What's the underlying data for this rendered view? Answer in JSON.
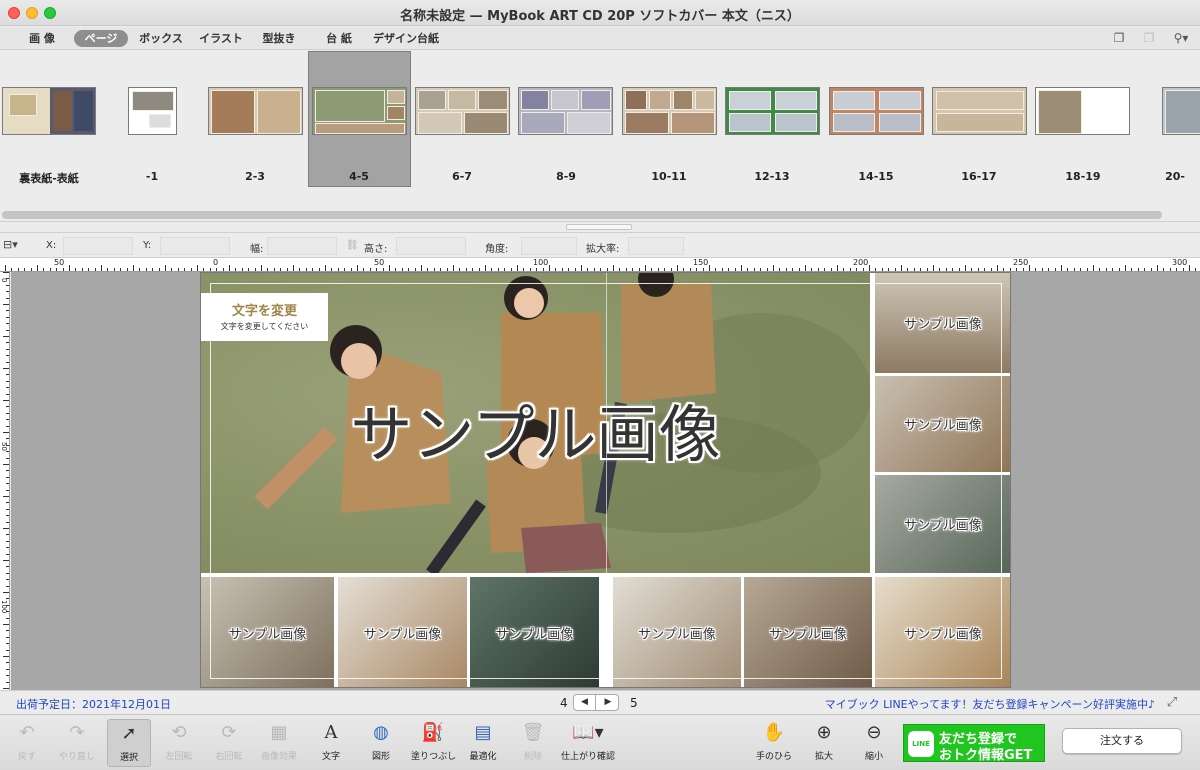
{
  "window": {
    "title": "名称未設定 — MyBook ART CD 20P ソフトカバー 本文（ニス）"
  },
  "menu": {
    "tabs": [
      {
        "label": "画 像",
        "active": false
      },
      {
        "label": "ページ",
        "active": true
      },
      {
        "label": "ボックス",
        "active": false
      },
      {
        "label": "イラスト",
        "active": false
      },
      {
        "label": "型抜き",
        "active": false
      },
      {
        "label": "台 紙",
        "active": false
      },
      {
        "label": "デザイン台紙",
        "active": false
      }
    ],
    "right_icons": [
      "window-icon",
      "copy-window-icon",
      "search-icon"
    ]
  },
  "pages": {
    "selected": "4-5",
    "items": [
      {
        "label": "裏表紙-表紙"
      },
      {
        "label": "-1"
      },
      {
        "label": "2-3"
      },
      {
        "label": "4-5"
      },
      {
        "label": "6-7"
      },
      {
        "label": "8-9"
      },
      {
        "label": "10-11"
      },
      {
        "label": "12-13"
      },
      {
        "label": "14-15"
      },
      {
        "label": "16-17"
      },
      {
        "label": "18-19"
      },
      {
        "label": "20-"
      }
    ]
  },
  "properties": {
    "x_label": "X:",
    "y_label": "Y:",
    "width_label": "幅:",
    "height_label": "高さ:",
    "angle_label": "角度:",
    "scale_label": "拡大率:",
    "x": "",
    "y": "",
    "width": "",
    "height": "",
    "angle": "",
    "scale": ""
  },
  "ruler": {
    "top_labels": [
      "50",
      "0",
      "50",
      "100",
      "150",
      "200",
      "250",
      "300"
    ],
    "left_labels": [
      "0",
      "50",
      "100"
    ]
  },
  "spread": {
    "textbox_title": "文字を変更",
    "textbox_subtitle": "文字を変更してください",
    "main_placeholder": "サンプル画像",
    "placeholders": [
      "サンプル画像",
      "サンプル画像",
      "サンプル画像",
      "サンプル画像",
      "サンプル画像",
      "サンプル画像",
      "サンプル画像",
      "サンプル画像",
      "サンプル画像"
    ]
  },
  "status": {
    "ship_date": "出荷予定日：2021年12月01日",
    "left_page": "4",
    "right_page": "5",
    "promo": "マイブック LINEやってます！友だち登録キャンペーン好評実施中♪"
  },
  "toolbar": {
    "tools": [
      {
        "label": "戻す",
        "icon": "undo-icon",
        "enabled": false
      },
      {
        "label": "やり直し",
        "icon": "redo-icon",
        "enabled": false
      },
      {
        "label": "選択",
        "icon": "arrow-cursor-icon",
        "enabled": true,
        "selected": true
      },
      {
        "label": "左回転",
        "icon": "rotate-left-icon",
        "enabled": false
      },
      {
        "label": "右回転",
        "icon": "rotate-right-icon",
        "enabled": false
      },
      {
        "label": "画像効果",
        "icon": "image-effect-icon",
        "enabled": false
      },
      {
        "label": "文字",
        "icon": "text-icon",
        "enabled": true
      },
      {
        "label": "図形",
        "icon": "shape-icon",
        "enabled": true
      },
      {
        "label": "塗りつぶし",
        "icon": "paint-bucket-icon",
        "enabled": true
      },
      {
        "label": "最適化",
        "icon": "optimize-icon",
        "enabled": true
      },
      {
        "label": "削除",
        "icon": "trash-icon",
        "enabled": false
      },
      {
        "label": "仕上がり確認",
        "icon": "book-preview-icon",
        "enabled": true
      },
      {
        "label": "手のひら",
        "icon": "hand-icon",
        "enabled": true
      },
      {
        "label": "拡大",
        "icon": "zoom-in-icon",
        "enabled": true
      },
      {
        "label": "縮小",
        "icon": "zoom-out-icon",
        "enabled": true
      }
    ],
    "line_banner_logo": "LINE",
    "line_banner_line1": "友だち登録で",
    "line_banner_line2": "おトク情報GET",
    "order_label": "注文する"
  },
  "colors": {
    "accent_blue": "#1f45c9",
    "line_green": "#20c51f",
    "textbox_gold": "#a0844a"
  }
}
